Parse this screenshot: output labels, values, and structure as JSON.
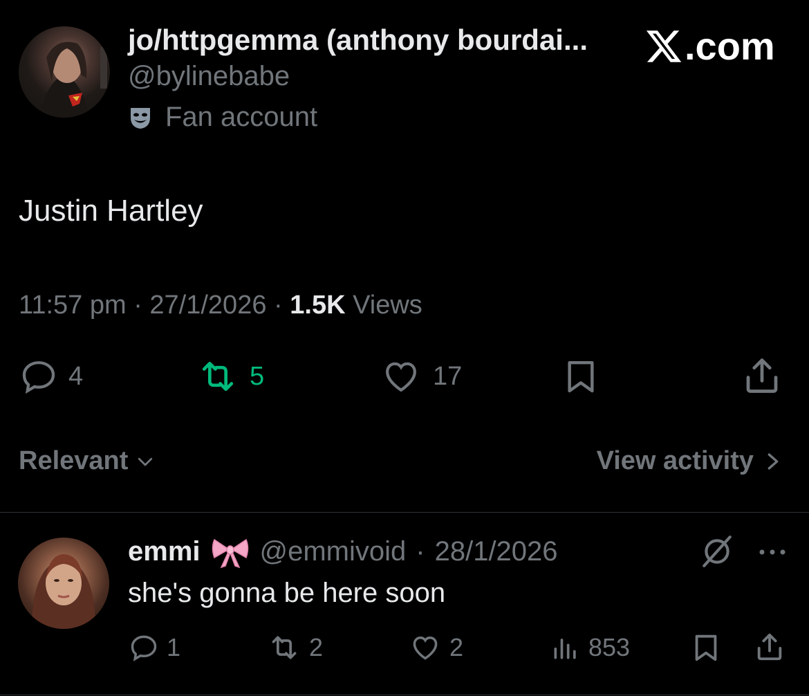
{
  "post": {
    "author_name": "jo/httpgemma (anthony bourdai...",
    "author_handle": "@bylinebabe",
    "badge_label": "Fan account",
    "site_label": ".com",
    "text": "Justin Hartley",
    "time": "11:57 pm",
    "date": "27/1/2026",
    "views_count": "1.5K",
    "views_label": "Views",
    "separator": "·",
    "stats": {
      "replies": "4",
      "reposts": "5",
      "likes": "17"
    }
  },
  "replies_bar": {
    "sort_label": "Relevant",
    "activity_label": "View activity"
  },
  "reply": {
    "name": "emmi",
    "handle": "@emmivoid",
    "date": "28/1/2026",
    "separator": "·",
    "text": "she's gonna be here soon",
    "stats": {
      "replies": "1",
      "reposts": "2",
      "likes": "2",
      "views": "853"
    }
  },
  "colors": {
    "background": "#000000",
    "text": "#e7e9ea",
    "muted": "#71767b",
    "repost_active": "#00ba7c",
    "divider": "#2f3336"
  },
  "icons": [
    "reply-icon",
    "repost-icon",
    "like-icon",
    "bookmark-icon",
    "share-icon",
    "chevron-down-icon",
    "chevron-right-icon",
    "theater-masks-icon",
    "bow-icon",
    "grok-icon",
    "more-icon",
    "views-icon",
    "x-logo-icon"
  ]
}
